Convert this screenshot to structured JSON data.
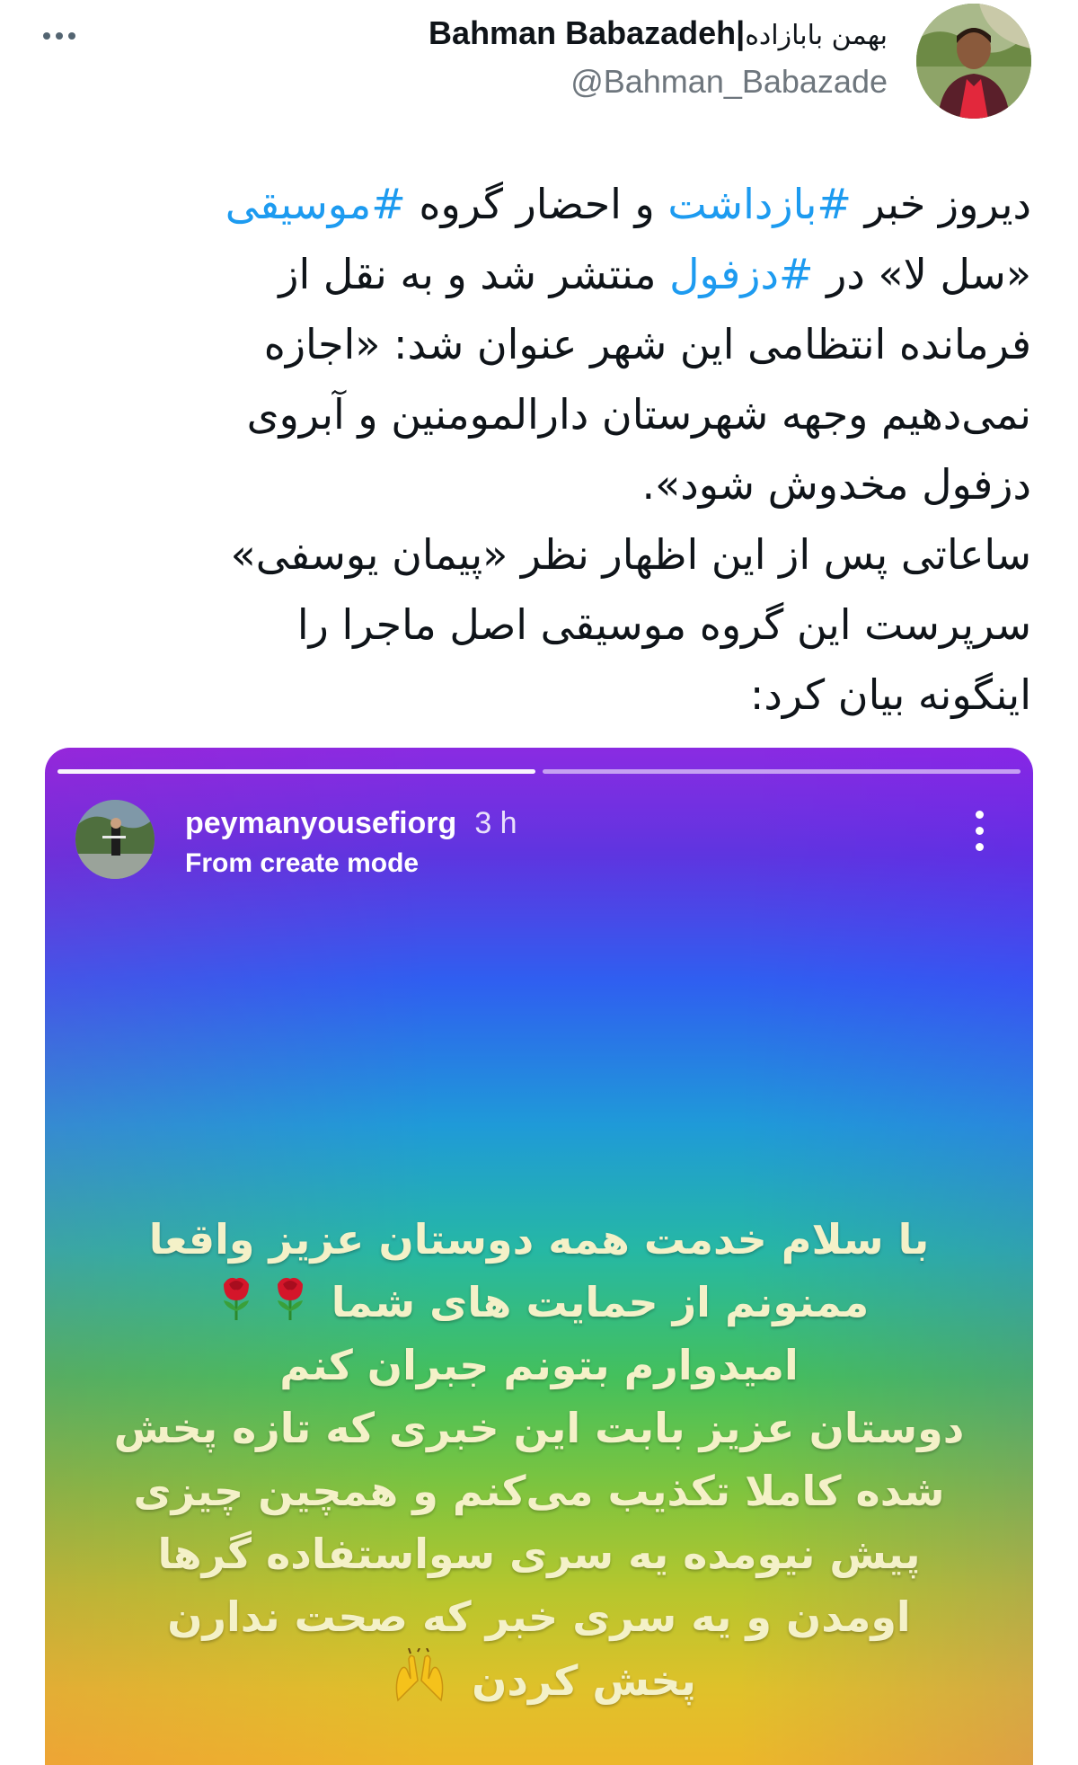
{
  "tweet": {
    "display_name": "Bahman Babazadeh",
    "display_name_separator": "|",
    "display_name_persian": "بهمن بابازاده",
    "handle": "@Bahman_Babazade",
    "more_icon": "more-horizontal-icon",
    "lines": [
      [
        {
          "t": "دیروز خبر "
        },
        {
          "t": "#بازداشت",
          "tag": true
        },
        {
          "t": " و احضار گروه "
        },
        {
          "t": "#موسیقی",
          "tag": true
        }
      ],
      [
        {
          "t": "«سل لا» در "
        },
        {
          "t": "#دزفول",
          "tag": true
        },
        {
          "t": " منتشر شد و به نقل از"
        }
      ],
      [
        {
          "t": "فرمانده انتظامی این شهر عنوان شد: «اجازه"
        }
      ],
      [
        {
          "t": "نمی‌دهیم وجهه شهرستان دارالمومنین و آبروی"
        }
      ],
      [
        {
          "t": "دزفول مخدوش شود»."
        }
      ],
      [
        {
          "t": "ساعاتی پس از این اظهار نظر «پیمان یوسفی»"
        }
      ],
      [
        {
          "t": "سرپرست این گروه موسیقی اصل ماجرا را"
        }
      ],
      [
        {
          "t": "اینگونه بیان کرد:"
        }
      ]
    ]
  },
  "story": {
    "username": "peymanyousefiorg",
    "time": "3 h",
    "subtitle": "From create mode",
    "menu_icon": "more-vertical-icon",
    "progress_segments": 2,
    "progress_done": 1,
    "lines": [
      "با سلام خدمت همه دوستان عزیز واقعا",
      "ممنونم از حمایت های شما",
      "امیدوارم بتونم جبران کنم",
      "دوستان عزیز بابت این خبری که تازه پخش",
      "شده کاملا تکذیب می‌کنم و همچین چیزی",
      "پیش نیومده یه سری سواستفاده گرها",
      "اومدن و یه سری خبر که صحت ندارن",
      "پخش کردن"
    ],
    "emoji_after_line_2": [
      "rose-icon",
      "rose-icon"
    ],
    "emoji_after_line_8": [
      "raising-hands-icon"
    ]
  }
}
